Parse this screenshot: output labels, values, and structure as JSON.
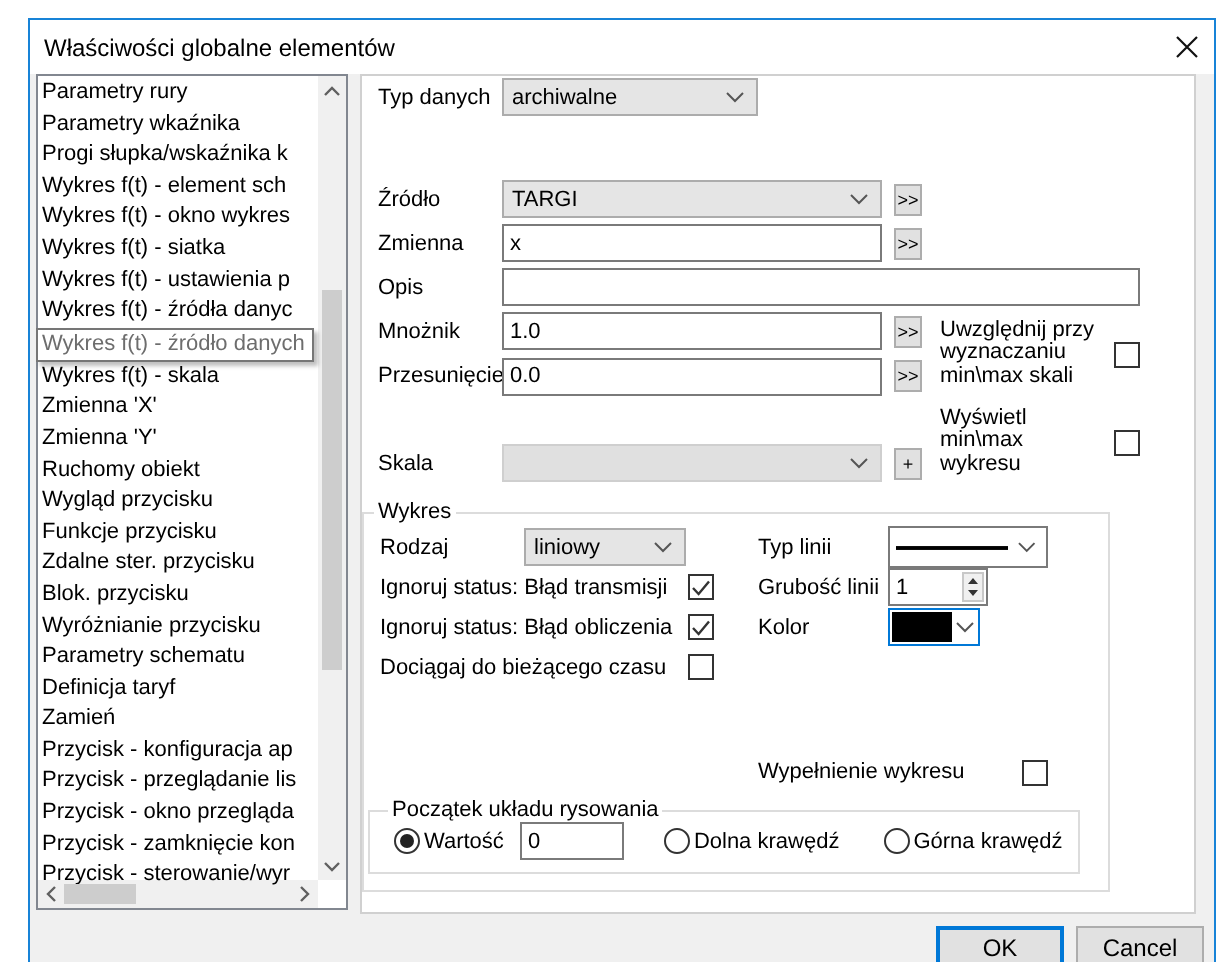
{
  "window": {
    "title": "Właściwości globalne elementów"
  },
  "sidebar": {
    "items": [
      {
        "label": "Parametry rury",
        "kind": "item"
      },
      {
        "label": "Parametry wkaźnika",
        "kind": "item"
      },
      {
        "label": "Progi słupka/wskaźnika k",
        "kind": "item"
      },
      {
        "label": "Wykres f(t) - element sch",
        "kind": "item"
      },
      {
        "label": "Wykres f(t) - okno wykres",
        "kind": "item"
      },
      {
        "label": "Wykres f(t) - siatka",
        "kind": "item"
      },
      {
        "label": "Wykres f(t) - ustawienia p",
        "kind": "item"
      },
      {
        "label": "Wykres f(t) - źródła danyc",
        "kind": "item"
      },
      {
        "label": "Wykres f(t) - źródło danych",
        "kind": "tooltip"
      },
      {
        "label": "Wykres f(t) - skala",
        "kind": "item"
      },
      {
        "label": "Zmienna 'X'",
        "kind": "item"
      },
      {
        "label": "Zmienna 'Y'",
        "kind": "item"
      },
      {
        "label": "Ruchomy obiekt",
        "kind": "item"
      },
      {
        "label": "Wygląd przycisku",
        "kind": "item"
      },
      {
        "label": "Funkcje przycisku",
        "kind": "item"
      },
      {
        "label": "Zdalne ster. przycisku",
        "kind": "item"
      },
      {
        "label": "Blok. przycisku",
        "kind": "item"
      },
      {
        "label": "Wyróżnianie przycisku",
        "kind": "item"
      },
      {
        "label": "Parametry schematu",
        "kind": "item"
      },
      {
        "label": "Definicja taryf",
        "kind": "item"
      },
      {
        "label": "Zamień",
        "kind": "item"
      },
      {
        "label": "Przycisk - konfiguracja ap",
        "kind": "item"
      },
      {
        "label": "Przycisk - przeglądanie lis",
        "kind": "item"
      },
      {
        "label": "Przycisk - okno przegląda",
        "kind": "item"
      },
      {
        "label": "Przycisk - zamknięcie kon",
        "kind": "item"
      },
      {
        "label": "Przycisk - sterowanie/wyr",
        "kind": "item"
      }
    ]
  },
  "form": {
    "data_type": {
      "label": "Typ danych",
      "value": "archiwalne"
    },
    "source": {
      "label": "Źródło",
      "value": "TARGI",
      "button": ">>"
    },
    "variable": {
      "label": "Zmienna",
      "value": "x",
      "button": ">>"
    },
    "description": {
      "label": "Opis"
    },
    "multiplier": {
      "label": "Mnożnik",
      "value": "1.0",
      "button": ">>"
    },
    "offset": {
      "label": "Przesunięcie",
      "value": "0.0",
      "button": ">>"
    },
    "include_in_scale": {
      "label": "Uwzględnij przy wyznaczaniu min\\max skali",
      "checked": false
    },
    "show_minmax": {
      "label": "Wyświetl min\\max wykresu",
      "checked": false
    },
    "scale": {
      "label": "Skala",
      "disabled": true,
      "button": "+"
    }
  },
  "chart_group": {
    "title": "Wykres",
    "type": {
      "label": "Rodzaj",
      "value": "liniowy"
    },
    "checks": [
      {
        "label": "Ignoruj status: Błąd transmisji",
        "checked": true
      },
      {
        "label": "Ignoruj status: Błąd obliczenia",
        "checked": true
      },
      {
        "label": "Dociągaj do bieżącego czasu",
        "checked": false
      }
    ],
    "line_type": {
      "label": "Typ linii"
    },
    "line_width": {
      "label": "Grubość linii",
      "value": "1"
    },
    "line_color": {
      "label": "Kolor",
      "color": "#000000"
    },
    "fill": {
      "label": "Wypełnienie wykresu",
      "checked": false
    },
    "origin": {
      "title": "Początek układu rysowania",
      "value": "0",
      "options": [
        {
          "label": "Wartość",
          "selected": true
        },
        {
          "label": "Dolna krawędź",
          "selected": false
        },
        {
          "label": "Górna krawędź",
          "selected": false
        }
      ]
    }
  },
  "buttons": [
    {
      "label": "OK",
      "default": true
    },
    {
      "label": "Cancel",
      "default": false
    }
  ]
}
